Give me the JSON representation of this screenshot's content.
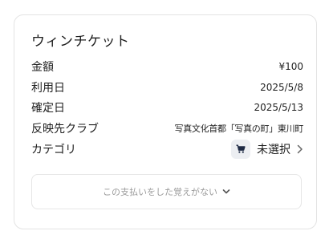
{
  "card": {
    "title": "ウィンチケット",
    "rows": [
      {
        "label": "金額",
        "value": "¥100"
      },
      {
        "label": "利用日",
        "value": "2025/5/8"
      },
      {
        "label": "確定日",
        "value": "2025/5/13"
      },
      {
        "label": "反映先クラブ",
        "value": "写真文化首都「写真の町」東川町"
      },
      {
        "label": "カテゴリ",
        "value": "未選択"
      }
    ],
    "category_icon": "cart-icon",
    "report_button": "この支払いをした覚えがない"
  },
  "colors": {
    "border": "#e3e3e3",
    "muted_text": "#9a9a9a",
    "badge_bg": "#eceef2"
  }
}
